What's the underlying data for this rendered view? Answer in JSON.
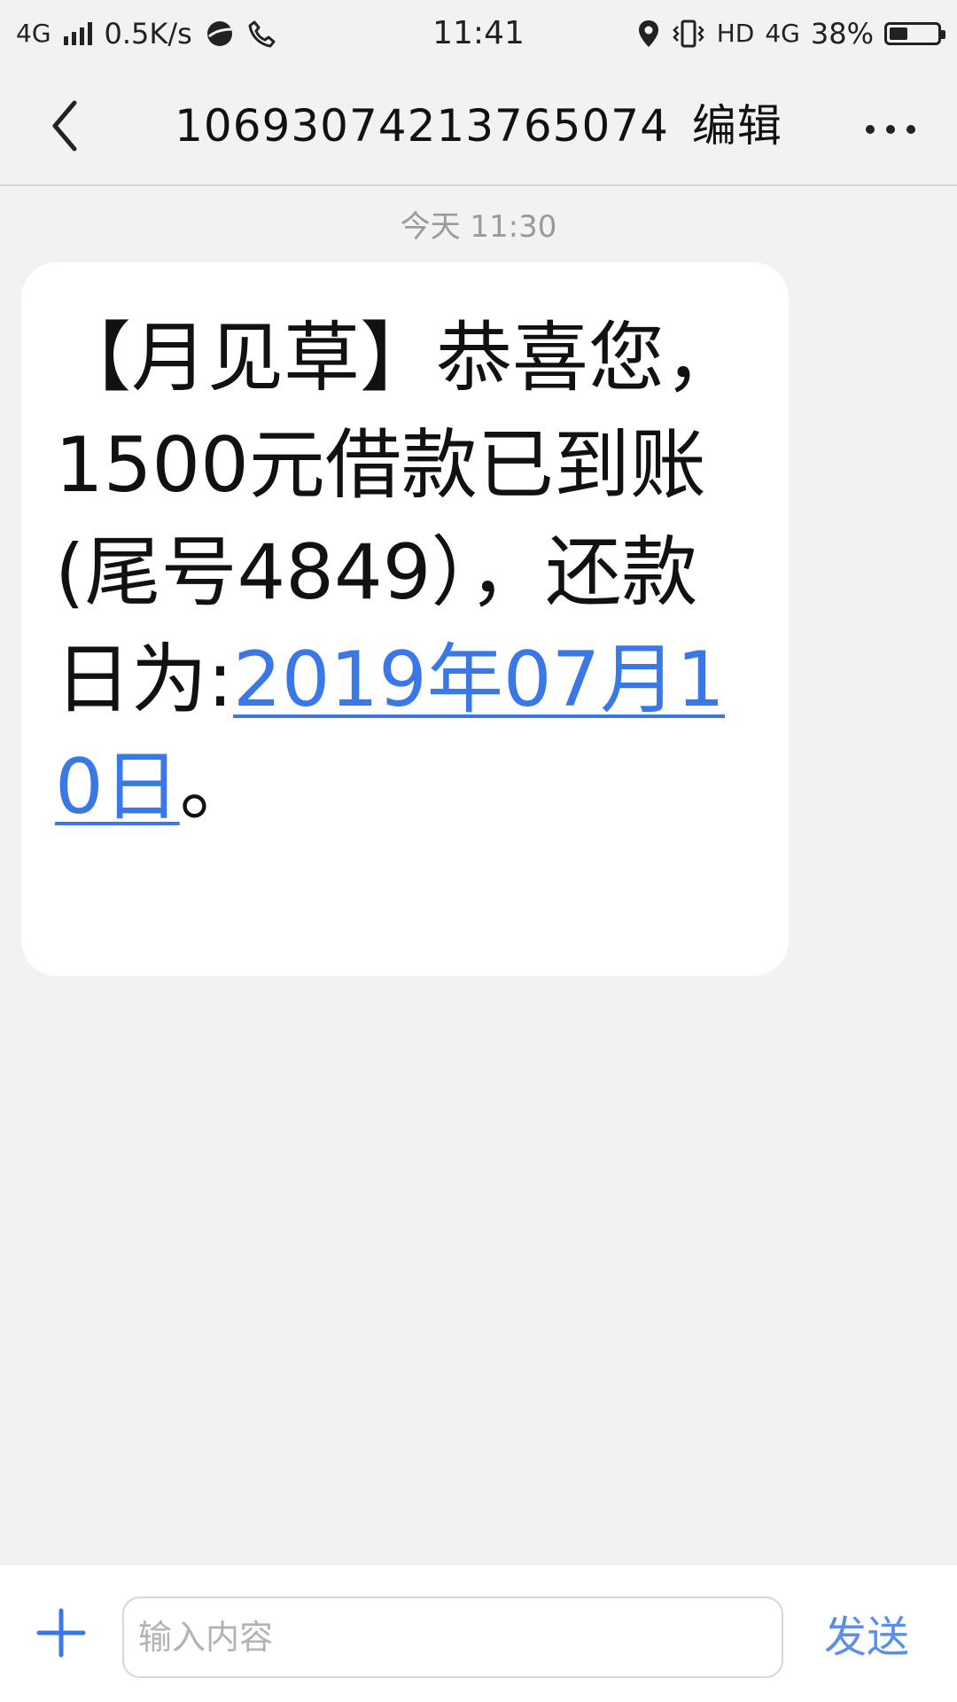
{
  "status_bar": {
    "network_type": "4G",
    "speed": "0.5K/s",
    "time": "11:41",
    "hd": "HD",
    "network_type_right": "4G",
    "battery": "38%",
    "battery_level": 0.38,
    "icons": [
      "signal-icon",
      "browser-icon",
      "phone-call-icon",
      "location-icon",
      "vibrate-icon",
      "battery-icon"
    ]
  },
  "header": {
    "title": "10693074213765074",
    "edit_label": "编辑",
    "back_icon": "back-arrow-icon",
    "more_icon": "more-icon"
  },
  "conversation": {
    "timestamp": "今天 11:30",
    "messages": [
      {
        "text_before": "【月见草】恭喜您，1500元借款已到账(尾号4849），还款日为:",
        "link_text": "2019年07月10日",
        "text_after": "。"
      }
    ]
  },
  "composer": {
    "placeholder": "输入内容",
    "send_label": "发送",
    "plus_icon": "plus-icon"
  },
  "colors": {
    "background": "#f2f2f2",
    "bubble": "#ffffff",
    "link": "#3b78e7",
    "send": "#5a8ee8",
    "timestamp": "#9a9a9a"
  }
}
